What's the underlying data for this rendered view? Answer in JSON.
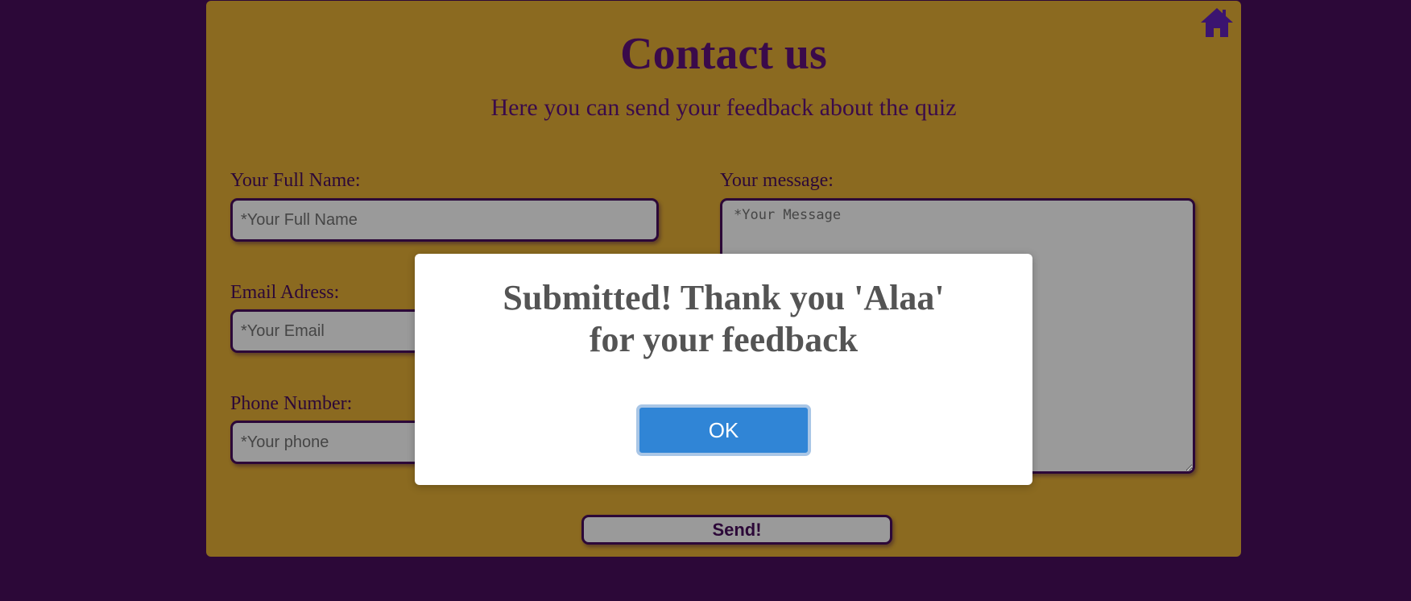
{
  "header": {
    "title": "Contact us",
    "subtitle": "Here you can send your feedback about the quiz",
    "home_icon": "home-icon"
  },
  "form": {
    "name_label": "Your Full Name:",
    "name_placeholder": "*Your Full Name",
    "email_label": "Email Adress:",
    "email_placeholder": "*Your Email",
    "phone_label": "Phone Number:",
    "phone_placeholder": "*Your phone",
    "message_label": "Your message:",
    "message_placeholder": "*Your Message",
    "send_label": "Send!"
  },
  "modal": {
    "message_line1": "Submitted! Thank you 'Alaa'",
    "message_line2": "for your feedback",
    "ok_label": "OK"
  },
  "colors": {
    "page_background": "#2c0838",
    "card_background": "#8b6a20",
    "field_background": "#9a9a9a",
    "accent_text": "#3a0a4a",
    "ok_button": "#3085d6"
  }
}
